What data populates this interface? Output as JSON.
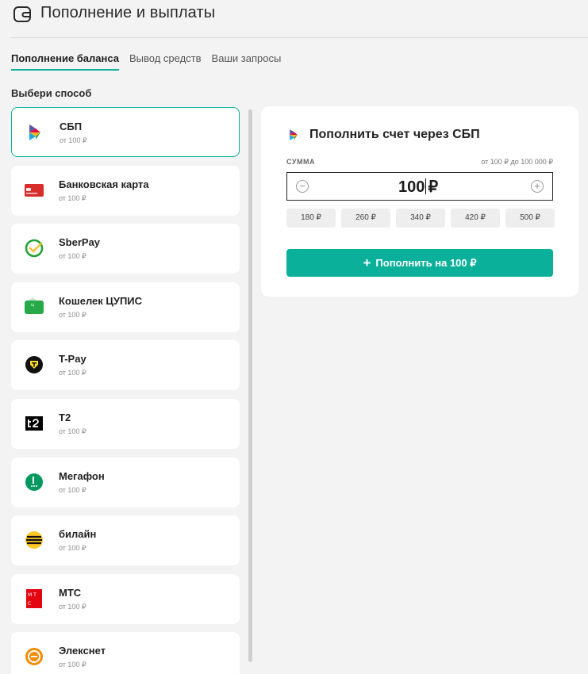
{
  "header": {
    "title": "Пополнение и выплаты",
    "icon": "wallet-icon"
  },
  "tabs": [
    {
      "label": "Пополнение баланса",
      "active": true
    },
    {
      "label": "Вывод средств",
      "active": false
    },
    {
      "label": "Ваши запросы",
      "active": false
    }
  ],
  "choose_label": "Выбери способ",
  "methods": [
    {
      "name": "СБП",
      "sub": "от 100 ₽",
      "icon": "sbp-icon",
      "selected": true
    },
    {
      "name": "Банковская карта",
      "sub": "от 100 ₽",
      "icon": "bank-card-icon"
    },
    {
      "name": "SberPay",
      "sub": "от 100 ₽",
      "icon": "sberpay-icon"
    },
    {
      "name": "Кошелек ЦУПИС",
      "sub": "от 100 ₽",
      "icon": "cupis-wallet-icon"
    },
    {
      "name": "T-Pay",
      "sub": "от 100 ₽",
      "icon": "tpay-icon"
    },
    {
      "name": "T2",
      "sub": "от 100 ₽",
      "icon": "t2-icon"
    },
    {
      "name": "Мегафон",
      "sub": "от 100 ₽",
      "icon": "megafon-icon"
    },
    {
      "name": "билайн",
      "sub": "от 100 ₽",
      "icon": "beeline-icon"
    },
    {
      "name": "МТС",
      "sub": "от 100 ₽",
      "icon": "mts-icon"
    },
    {
      "name": "Элекснет",
      "sub": "от 100 ₽",
      "icon": "eleksnet-icon"
    }
  ],
  "panel": {
    "title": "Пополнить счет через СБП",
    "sum_label": "СУММА",
    "range": "от 100 ₽ до 100 000 ₽",
    "amount": "100",
    "currency": "₽",
    "presets": [
      "180 ₽",
      "260 ₽",
      "340 ₽",
      "420 ₽",
      "500 ₽"
    ],
    "pay_label": "Пополнить на 100 ₽"
  },
  "colors": {
    "accent": "#0bb09a",
    "background": "#f3f3f3"
  }
}
